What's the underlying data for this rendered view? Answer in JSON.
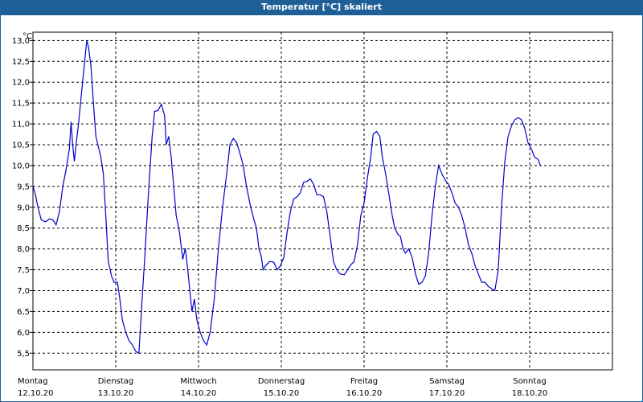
{
  "window": {
    "title": "Temperatur [°C] skaliert"
  },
  "chart_data": {
    "type": "line",
    "title": "Temperatur [°C] skaliert",
    "ylabel": "°C",
    "xlabel": "",
    "ylim": [
      5.1,
      13.2
    ],
    "xlim": [
      0,
      7
    ],
    "grid": true,
    "line_color": "#0000cc",
    "y_ticks": [
      "5,5",
      "6,0",
      "6,5",
      "7,0",
      "7,5",
      "8,0",
      "8,5",
      "9,0",
      "9,5",
      "10,0",
      "10,5",
      "11,0",
      "11,5",
      "12,0",
      "12,5",
      "13,0"
    ],
    "y_tick_values": [
      5.5,
      6.0,
      6.5,
      7.0,
      7.5,
      8.0,
      8.5,
      9.0,
      9.5,
      10.0,
      10.5,
      11.0,
      11.5,
      12.0,
      12.5,
      13.0
    ],
    "x_days": [
      {
        "day": "Montag",
        "date": "12.10.20"
      },
      {
        "day": "Dienstag",
        "date": "13.10.20"
      },
      {
        "day": "Mittwoch",
        "date": "14.10.20"
      },
      {
        "day": "Donnerstag",
        "date": "15.10.20"
      },
      {
        "day": "Freitag",
        "date": "16.10.20"
      },
      {
        "day": "Samstag",
        "date": "17.10.20"
      },
      {
        "day": "Sonntag",
        "date": "18.10.20"
      }
    ],
    "series": [
      {
        "values": [
          [
            0.0,
            9.5
          ],
          [
            0.03,
            9.3
          ],
          [
            0.06,
            9.0
          ],
          [
            0.1,
            8.7
          ],
          [
            0.15,
            8.65
          ],
          [
            0.2,
            8.72
          ],
          [
            0.24,
            8.7
          ],
          [
            0.28,
            8.58
          ],
          [
            0.32,
            8.9
          ],
          [
            0.36,
            9.5
          ],
          [
            0.4,
            9.9
          ],
          [
            0.44,
            10.4
          ],
          [
            0.46,
            11.05
          ],
          [
            0.48,
            10.5
          ],
          [
            0.5,
            10.1
          ],
          [
            0.52,
            10.5
          ],
          [
            0.55,
            11.0
          ],
          [
            0.58,
            11.6
          ],
          [
            0.61,
            12.2
          ],
          [
            0.64,
            12.8
          ],
          [
            0.65,
            13.0
          ],
          [
            0.67,
            12.85
          ],
          [
            0.7,
            12.4
          ],
          [
            0.73,
            11.5
          ],
          [
            0.76,
            10.7
          ],
          [
            0.79,
            10.45
          ],
          [
            0.82,
            10.2
          ],
          [
            0.85,
            9.8
          ],
          [
            0.88,
            8.8
          ],
          [
            0.91,
            7.7
          ],
          [
            0.95,
            7.35
          ],
          [
            0.98,
            7.2
          ],
          [
            1.02,
            7.2
          ],
          [
            1.05,
            6.8
          ],
          [
            1.08,
            6.3
          ],
          [
            1.12,
            6.0
          ],
          [
            1.16,
            5.8
          ],
          [
            1.2,
            5.7
          ],
          [
            1.24,
            5.55
          ],
          [
            1.28,
            5.5
          ],
          [
            1.31,
            6.5
          ],
          [
            1.35,
            7.8
          ],
          [
            1.4,
            9.5
          ],
          [
            1.44,
            10.7
          ],
          [
            1.47,
            11.3
          ],
          [
            1.51,
            11.32
          ],
          [
            1.55,
            11.47
          ],
          [
            1.59,
            11.2
          ],
          [
            1.61,
            10.5
          ],
          [
            1.64,
            10.7
          ],
          [
            1.67,
            10.2
          ],
          [
            1.7,
            9.5
          ],
          [
            1.73,
            8.8
          ],
          [
            1.77,
            8.4
          ],
          [
            1.81,
            7.75
          ],
          [
            1.84,
            8.02
          ],
          [
            1.87,
            7.5
          ],
          [
            1.9,
            6.9
          ],
          [
            1.92,
            6.5
          ],
          [
            1.95,
            6.8
          ],
          [
            1.98,
            6.3
          ],
          [
            2.02,
            6.0
          ],
          [
            2.06,
            5.8
          ],
          [
            2.1,
            5.7
          ],
          [
            2.14,
            6.0
          ],
          [
            2.19,
            6.8
          ],
          [
            2.24,
            8.0
          ],
          [
            2.29,
            9.0
          ],
          [
            2.34,
            9.8
          ],
          [
            2.38,
            10.5
          ],
          [
            2.42,
            10.65
          ],
          [
            2.46,
            10.55
          ],
          [
            2.5,
            10.3
          ],
          [
            2.54,
            10.0
          ],
          [
            2.58,
            9.5
          ],
          [
            2.63,
            9.0
          ],
          [
            2.67,
            8.7
          ],
          [
            2.7,
            8.5
          ],
          [
            2.73,
            8.0
          ],
          [
            2.76,
            7.8
          ],
          [
            2.78,
            7.5
          ],
          [
            2.81,
            7.6
          ],
          [
            2.86,
            7.7
          ],
          [
            2.91,
            7.68
          ],
          [
            2.95,
            7.5
          ],
          [
            2.99,
            7.6
          ],
          [
            3.03,
            7.8
          ],
          [
            3.07,
            8.4
          ],
          [
            3.11,
            8.9
          ],
          [
            3.15,
            9.2
          ],
          [
            3.19,
            9.25
          ],
          [
            3.23,
            9.35
          ],
          [
            3.27,
            9.6
          ],
          [
            3.31,
            9.62
          ],
          [
            3.35,
            9.68
          ],
          [
            3.39,
            9.55
          ],
          [
            3.43,
            9.3
          ],
          [
            3.47,
            9.3
          ],
          [
            3.51,
            9.25
          ],
          [
            3.55,
            8.9
          ],
          [
            3.59,
            8.3
          ],
          [
            3.63,
            7.7
          ],
          [
            3.67,
            7.5
          ],
          [
            3.71,
            7.4
          ],
          [
            3.76,
            7.38
          ],
          [
            3.8,
            7.5
          ],
          [
            3.84,
            7.62
          ],
          [
            3.88,
            7.7
          ],
          [
            3.92,
            8.1
          ],
          [
            3.96,
            8.8
          ],
          [
            4.0,
            9.1
          ],
          [
            4.04,
            9.7
          ],
          [
            4.08,
            10.2
          ],
          [
            4.11,
            10.75
          ],
          [
            4.15,
            10.82
          ],
          [
            4.19,
            10.7
          ],
          [
            4.22,
            10.2
          ],
          [
            4.26,
            9.8
          ],
          [
            4.3,
            9.3
          ],
          [
            4.34,
            8.8
          ],
          [
            4.37,
            8.5
          ],
          [
            4.41,
            8.35
          ],
          [
            4.44,
            8.3
          ],
          [
            4.47,
            8.0
          ],
          [
            4.5,
            7.9
          ],
          [
            4.54,
            8.0
          ],
          [
            4.58,
            7.8
          ],
          [
            4.62,
            7.4
          ],
          [
            4.66,
            7.15
          ],
          [
            4.7,
            7.2
          ],
          [
            4.74,
            7.35
          ],
          [
            4.78,
            7.9
          ],
          [
            4.82,
            8.8
          ],
          [
            4.86,
            9.5
          ],
          [
            4.9,
            10.0
          ],
          [
            4.94,
            9.8
          ],
          [
            4.98,
            9.65
          ],
          [
            5.02,
            9.55
          ],
          [
            5.06,
            9.35
          ],
          [
            5.1,
            9.1
          ],
          [
            5.14,
            9.0
          ],
          [
            5.18,
            8.8
          ],
          [
            5.22,
            8.5
          ],
          [
            5.26,
            8.1
          ],
          [
            5.3,
            7.9
          ],
          [
            5.34,
            7.6
          ],
          [
            5.38,
            7.4
          ],
          [
            5.42,
            7.2
          ],
          [
            5.46,
            7.2
          ],
          [
            5.5,
            7.1
          ],
          [
            5.54,
            7.05
          ],
          [
            5.58,
            7.0
          ],
          [
            5.62,
            7.5
          ],
          [
            5.66,
            9.0
          ],
          [
            5.7,
            10.1
          ],
          [
            5.74,
            10.7
          ],
          [
            5.78,
            10.95
          ],
          [
            5.82,
            11.1
          ],
          [
            5.86,
            11.15
          ],
          [
            5.9,
            11.1
          ],
          [
            5.94,
            10.9
          ],
          [
            5.98,
            10.55
          ],
          [
            6.02,
            10.4
          ],
          [
            6.06,
            10.2
          ],
          [
            6.1,
            10.15
          ],
          [
            6.13,
            10.0
          ]
        ]
      }
    ]
  }
}
